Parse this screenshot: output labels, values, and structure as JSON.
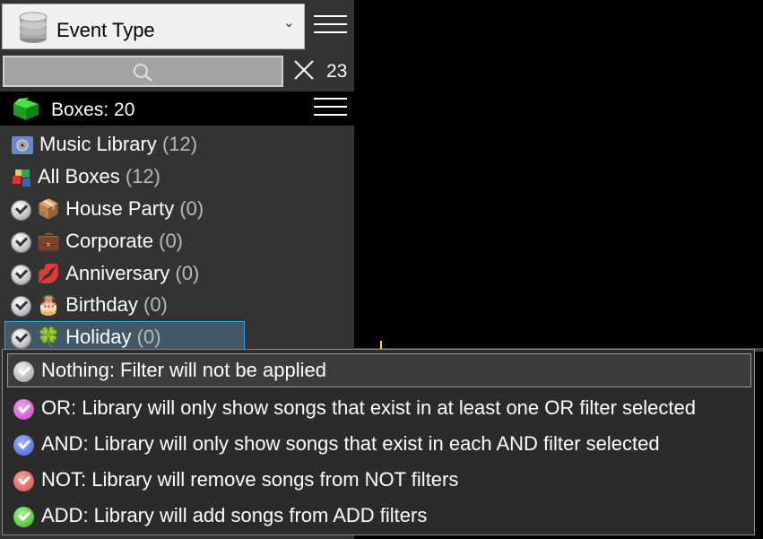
{
  "selector": {
    "label": "Event Type"
  },
  "search": {
    "placeholder": ""
  },
  "result_count": "23",
  "boxes": {
    "title": "Boxes: 20"
  },
  "tree": {
    "music_library": {
      "label": "Music Library",
      "count": "(12)"
    },
    "all_boxes": {
      "label": "All Boxes",
      "count": "(12)"
    },
    "house_party": {
      "label": "House Party",
      "count": "(0)"
    },
    "corporate": {
      "label": "Corporate",
      "count": "(0)"
    },
    "anniversary": {
      "label": "Anniversary",
      "count": "(0)"
    },
    "birthday": {
      "label": "Birthday",
      "count": "(0)"
    },
    "holiday": {
      "label": "Holiday",
      "count": "(0)"
    }
  },
  "filter_menu": {
    "nothing": "Nothing: Filter will not be applied",
    "or": "OR: Library will only show songs that exist in at least one OR filter selected",
    "and": "AND: Library will only show songs that exist in each AND filter selected",
    "not": "NOT: Library will remove songs from NOT filters",
    "add": "ADD: Library will add songs from ADD filters"
  },
  "colors": {
    "nothing": "#b0b0b0",
    "or": "#d455d4",
    "and": "#5577e0",
    "not": "#e05b5b",
    "add": "#44cc22"
  }
}
